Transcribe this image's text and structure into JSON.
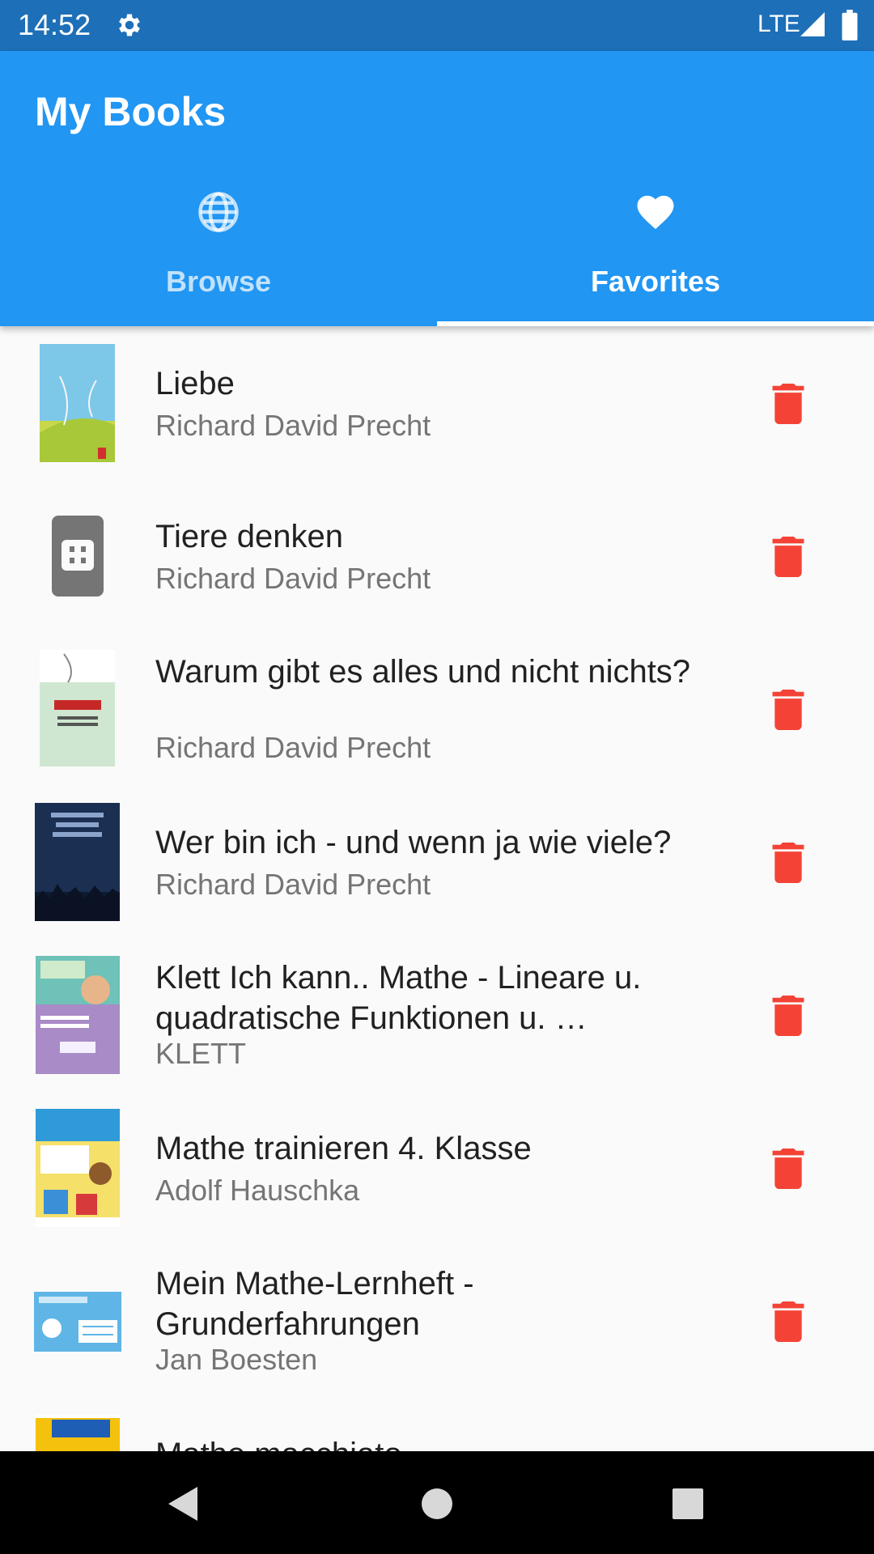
{
  "status_bar": {
    "time": "14:52",
    "network": "LTE",
    "icons": [
      "gear-icon",
      "signal-icon",
      "battery-icon"
    ]
  },
  "app": {
    "title": "My Books"
  },
  "tabs": [
    {
      "label": "Browse",
      "icon": "globe-icon",
      "selected": false
    },
    {
      "label": "Favorites",
      "icon": "heart-icon",
      "selected": true
    }
  ],
  "books": [
    {
      "title": "Liebe",
      "author": "Richard David Precht",
      "cover": "cover-liebe"
    },
    {
      "title": "Tiere denken",
      "author": "Richard David Precht",
      "cover": "placeholder-icon"
    },
    {
      "title": "Warum gibt es alles und nicht nichts?",
      "author": "Richard David Precht",
      "cover": "cover-warum"
    },
    {
      "title": "Wer bin ich - und wenn ja wie viele?",
      "author": "Richard David Precht",
      "cover": "cover-wer-bin-ich"
    },
    {
      "title": "Klett Ich kann.. Mathe - Lineare u. quadratische Funktionen u. …",
      "author": "KLETT",
      "cover": "cover-klett"
    },
    {
      "title": "Mathe trainieren 4. Klasse",
      "author": "Adolf Hauschka",
      "cover": "cover-mathe-trainieren"
    },
    {
      "title": "Mein Mathe-Lernheft - Grunderfahrungen",
      "author": "Jan Boesten",
      "cover": "cover-lernheft"
    },
    {
      "title": "Mathe macchiato",
      "author": "",
      "cover": "cover-macchiato"
    }
  ],
  "colors": {
    "status_bar": "#1d6fb8",
    "app_bar": "#2196f3",
    "delete": "#f44336",
    "background": "#fafafa"
  },
  "navigation": [
    "back-icon",
    "home-icon",
    "recents-icon"
  ]
}
